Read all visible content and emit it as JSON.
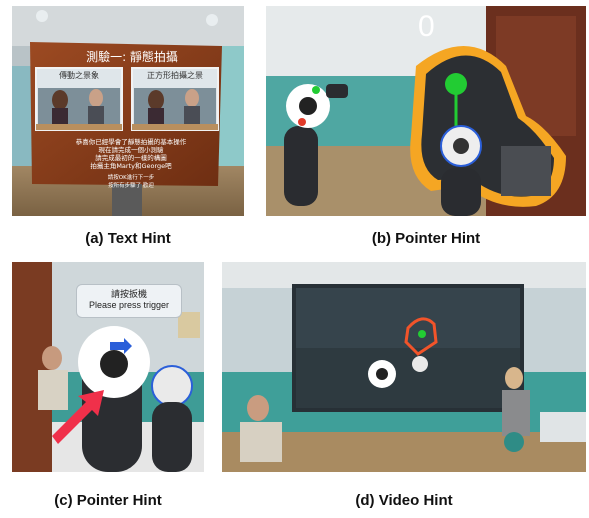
{
  "captions": {
    "a": "(a) Text Hint",
    "b": "(b) Pointer Hint",
    "c": "(c) Pointer Hint",
    "d": "(d) Video Hint"
  },
  "panel_a": {
    "board_title": "測驗一: 靜態拍攝",
    "left_image_label": "傳動之景象",
    "right_image_label": "正方形拍攝之景",
    "body_lines": [
      "恭喜你已經學會了靜態拍攝的基本操作",
      "現在請完成一個小測驗",
      "請完成最初的一樣的構圖",
      "拍攝主角Marty和George吧"
    ],
    "footer_lines": [
      "請按OK進行下一步",
      "按所有步驟了 歡迎"
    ]
  },
  "panel_b": {
    "counter": "0"
  },
  "panel_c": {
    "tooltip_line1": "請按扳機",
    "tooltip_line2": "Please press trigger"
  },
  "colors": {
    "highlight_orange": "#f5a623",
    "green": "#22cc33",
    "red_arrow": "#f0304a",
    "blue_arrow": "#2b5fd9"
  }
}
